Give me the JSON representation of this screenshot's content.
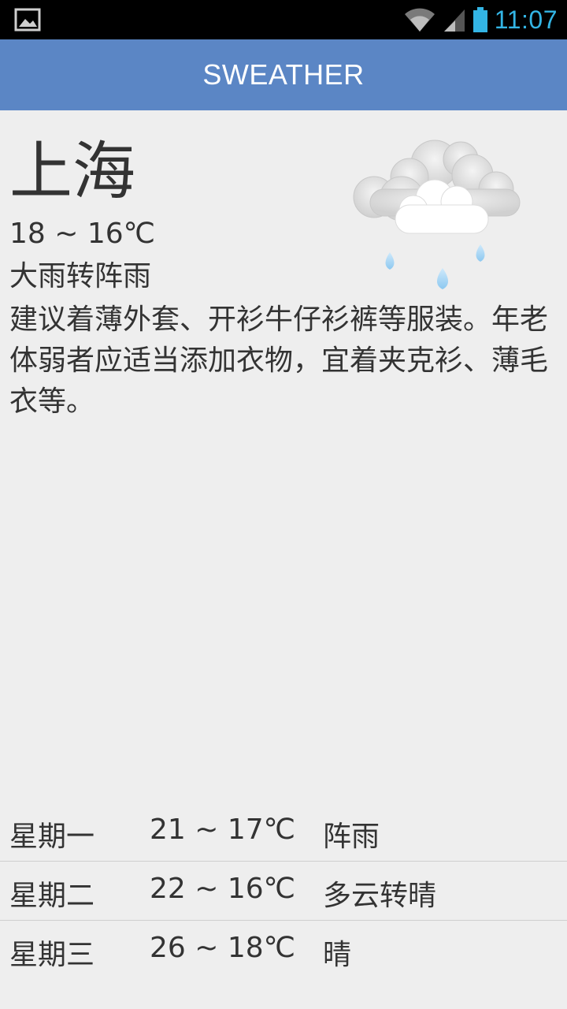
{
  "status_bar": {
    "time": "11:07",
    "left_icon": "image-notification-icon",
    "right_icons": [
      "wifi-icon",
      "signal-icon",
      "battery-icon"
    ],
    "time_color": "#33b5e5"
  },
  "app_bar": {
    "title": "SWEATHER",
    "color": "#5b86c5"
  },
  "today": {
    "city": "上海",
    "temperature": "18 ~ 16℃",
    "condition": "大雨转阵雨",
    "advice": "建议着薄外套、开衫牛仔衫裤等服装。年老体弱者应适当添加衣物，宜着夹克衫、薄毛衣等。",
    "icon": "cloud-rain-icon"
  },
  "forecast": [
    {
      "day": "星期一",
      "temp": "21 ~ 17℃",
      "condition": "阵雨"
    },
    {
      "day": "星期二",
      "temp": "22 ~ 16℃",
      "condition": "多云转晴"
    },
    {
      "day": "星期三",
      "temp": "26 ~ 18℃",
      "condition": "晴"
    }
  ]
}
